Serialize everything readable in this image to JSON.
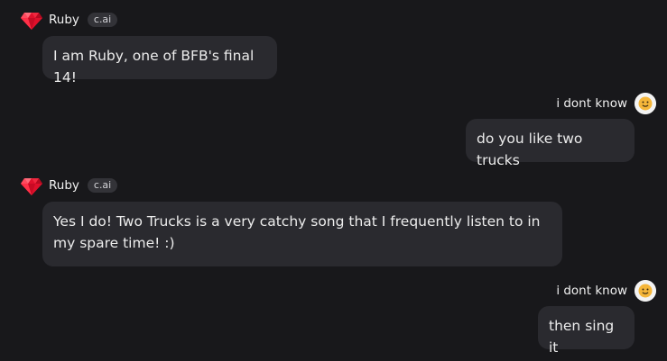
{
  "messages": [
    {
      "role": "bot",
      "author": "Ruby",
      "badge": "c.ai",
      "text": "I am Ruby, one of BFB's final 14!"
    },
    {
      "role": "user",
      "author": "i dont know",
      "text": "do you like two trucks"
    },
    {
      "role": "bot",
      "author": "Ruby",
      "badge": "c.ai",
      "text": "Yes I do! Two Trucks is a very catchy song that I frequently listen to in my spare time! :)"
    },
    {
      "role": "user",
      "author": "i dont know",
      "text": "then sing it"
    }
  ],
  "icons": {
    "bot_avatar": "ruby-gem-icon",
    "user_avatar": "smiley-avatar-icon"
  },
  "colors": {
    "background": "#18181b",
    "bubble": "#2a2a2f",
    "badge": "#333338",
    "ruby_red": "#e0102b",
    "avatar_face": "#f5b63a"
  }
}
